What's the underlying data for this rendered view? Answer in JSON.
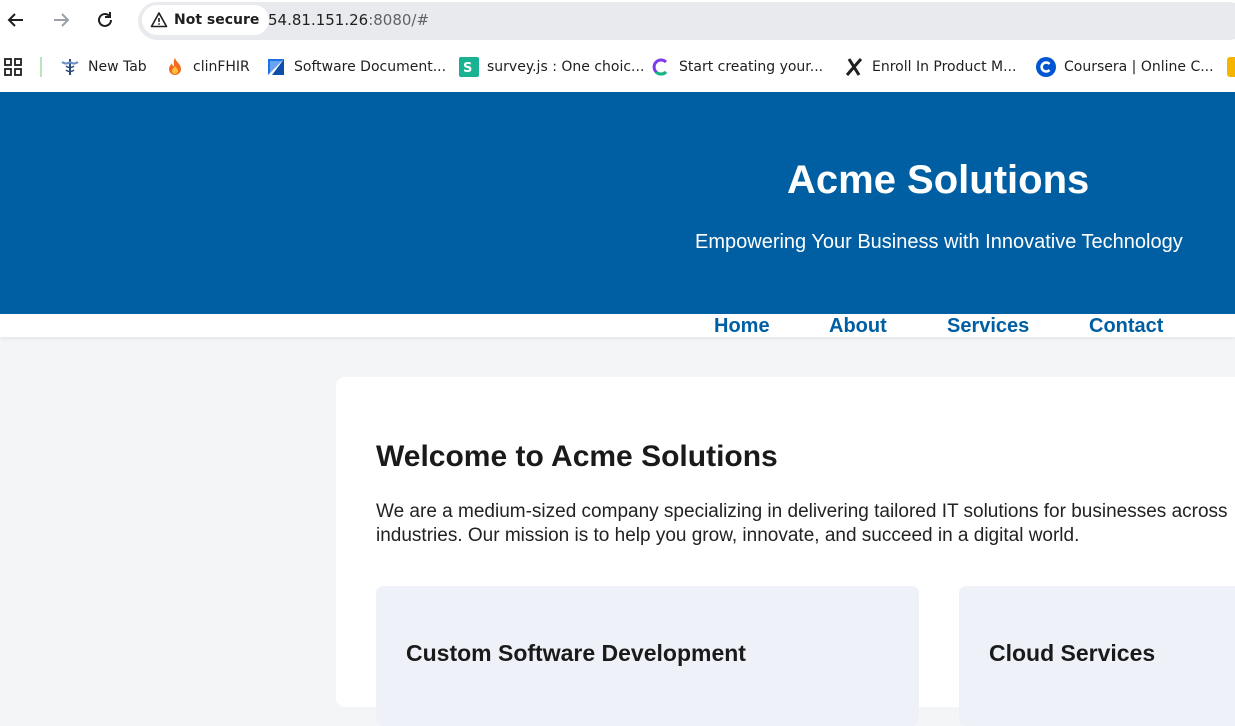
{
  "browser": {
    "security_label": "Not secure",
    "url_host": "54.81.151.26",
    "url_rest": ":8080/#",
    "bookmarks": [
      {
        "label": "New Tab",
        "icon": "caduceus-icon"
      },
      {
        "label": "clinFHIR",
        "icon": "flame-icon"
      },
      {
        "label": "Software Document...",
        "icon": "document-flag-icon"
      },
      {
        "label": "survey.js : One choic...",
        "icon": "surveyjs-icon"
      },
      {
        "label": "Start creating your...",
        "icon": "c-logo-icon"
      },
      {
        "label": "Enroll In Product M...",
        "icon": "x-logo-icon"
      },
      {
        "label": "Coursera | Online C...",
        "icon": "coursera-icon"
      }
    ]
  },
  "site": {
    "title": "Acme Solutions",
    "tagline": "Empowering Your Business with Innovative Technology",
    "nav": [
      "Home",
      "About",
      "Services",
      "Contact"
    ],
    "welcome_title": "Welcome to Acme Solutions",
    "welcome_text": "We are a medium-sized company specializing in delivering tailored IT solutions for businesses across industries. Our mission is to help you grow, innovate, and succeed in a digital world.",
    "services": [
      "Custom Software Development",
      "Cloud Services"
    ]
  },
  "colors": {
    "brand": "#005fa3",
    "page_bg": "#f4f5f7",
    "card_bg": "#eef2f8"
  }
}
